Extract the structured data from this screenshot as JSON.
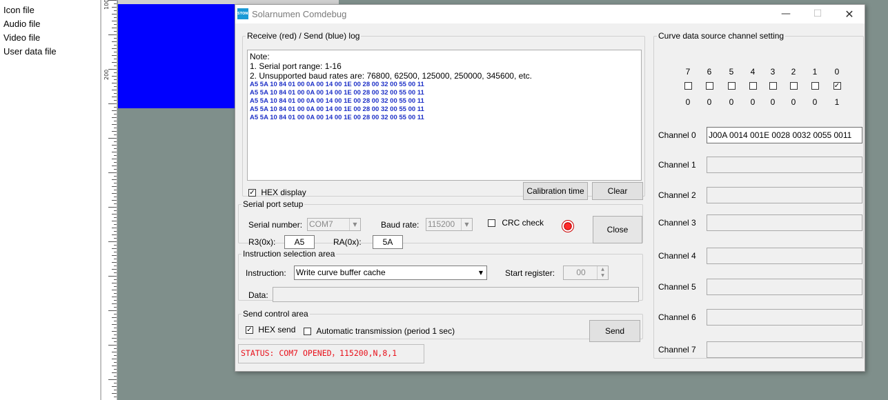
{
  "left_panel": {
    "items": [
      "Icon file",
      "Audio file",
      "Video file",
      "User data file"
    ]
  },
  "ruler": {
    "labels": [
      "100",
      "200"
    ]
  },
  "dialog": {
    "title": "Solarnumen Comdebug",
    "icon_text": "STONE",
    "min_symbol": "—",
    "max_symbol": "☐",
    "close_symbol": "✕"
  },
  "log": {
    "legend": "Receive (red) / Send (blue) log",
    "notes": [
      "Note:",
      "1. Serial port range: 1-16",
      "2. Unsupported baud rates are: 76800, 62500, 125000, 250000, 345600, etc."
    ],
    "hex_lines": [
      "A5 5A 10 84 01 00 0A 00 14 00 1E 00 28 00 32 00 55 00 11",
      "A5 5A 10 84 01 00 0A 00 14 00 1E 00 28 00 32 00 55 00 11",
      "A5 5A 10 84 01 00 0A 00 14 00 1E 00 28 00 32 00 55 00 11",
      "A5 5A 10 84 01 00 0A 00 14 00 1E 00 28 00 32 00 55 00 11",
      "A5 5A 10 84 01 00 0A 00 14 00 1E 00 28 00 32 00 55 00 11"
    ],
    "hex_display_label": "HEX display",
    "hex_display_checked": true,
    "calibration_button": "Calibration time",
    "clear_button": "Clear"
  },
  "serial": {
    "legend": "Serial port setup",
    "serial_number_label": "Serial number:",
    "serial_number_value": "COM7",
    "baud_label": "Baud rate:",
    "baud_value": "115200",
    "crc_label": "CRC check",
    "crc_checked": false,
    "r3_label": "R3(0x):",
    "r3_value": "A5",
    "ra_label": "RA(0x):",
    "ra_value": "5A",
    "close_button": "Close",
    "led_color": "#ff0000"
  },
  "instruction": {
    "legend": "Instruction selection area",
    "instruction_label": "Instruction:",
    "instruction_value": "Write curve buffer cache",
    "start_register_label": "Start register:",
    "start_register_value": "00",
    "data_label": "Data:",
    "data_value": ""
  },
  "send": {
    "legend": "Send control area",
    "hex_send_label": "HEX send",
    "hex_send_checked": true,
    "auto_label": "Automatic transmission (period 1 sec)",
    "auto_checked": false,
    "send_button": "Send"
  },
  "status": {
    "text": "STATUS: COM7 OPENED，115200,N,8,1",
    "color": "#e8101a"
  },
  "curve": {
    "legend": "Curve data source channel setting",
    "bits": [
      {
        "bit": "7",
        "checked": false,
        "value": "0"
      },
      {
        "bit": "6",
        "checked": false,
        "value": "0"
      },
      {
        "bit": "5",
        "checked": false,
        "value": "0"
      },
      {
        "bit": "4",
        "checked": false,
        "value": "0"
      },
      {
        "bit": "3",
        "checked": false,
        "value": "0"
      },
      {
        "bit": "2",
        "checked": false,
        "value": "0"
      },
      {
        "bit": "1",
        "checked": false,
        "value": "0"
      },
      {
        "bit": "0",
        "checked": true,
        "value": "1"
      }
    ],
    "channels": [
      {
        "label": "Channel 0",
        "value": "J00A 0014 001E 0028 0032 0055 0011"
      },
      {
        "label": "Channel 1",
        "value": ""
      },
      {
        "label": "Channel 2",
        "value": ""
      },
      {
        "label": "Channel 3",
        "value": ""
      },
      {
        "label": "Channel 4",
        "value": ""
      },
      {
        "label": "Channel 5",
        "value": ""
      },
      {
        "label": "Channel 6",
        "value": ""
      },
      {
        "label": "Channel 7",
        "value": ""
      }
    ]
  },
  "colors": {
    "canvas_bg": "#7f8f8b",
    "blue_shape": "#0000ff",
    "send_log": "#1d30c7"
  }
}
